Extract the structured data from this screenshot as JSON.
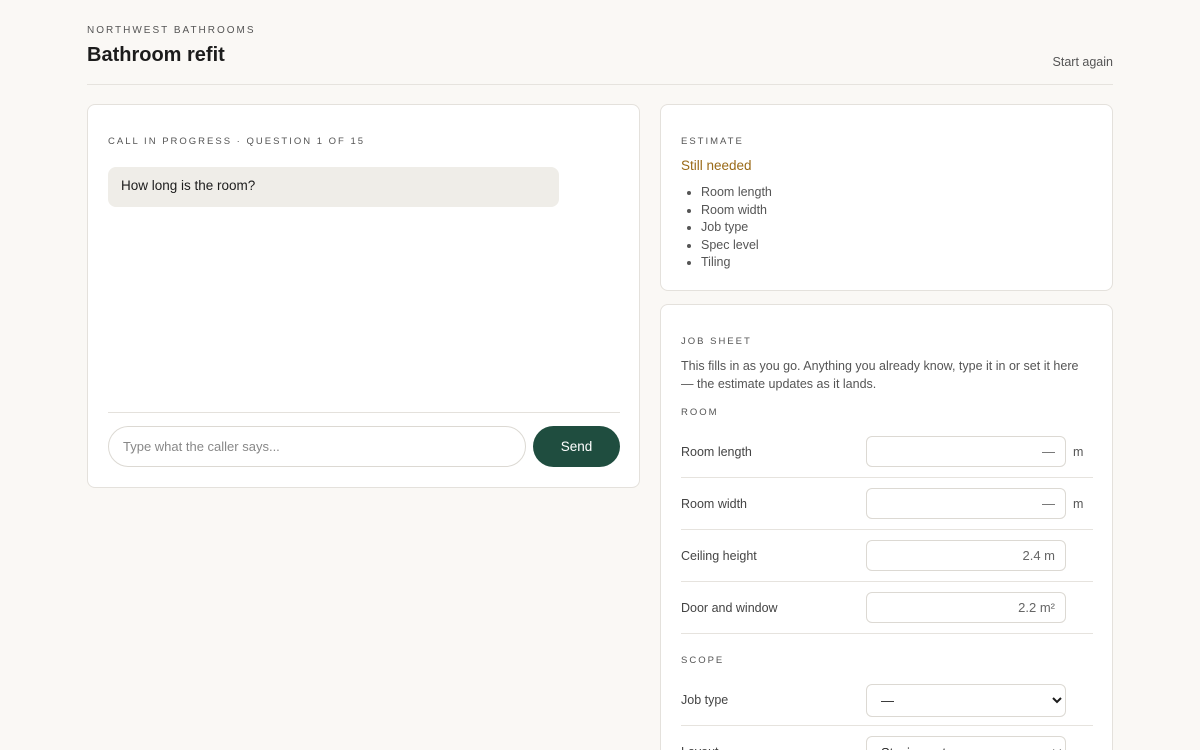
{
  "header": {
    "brand": "NORTHWEST BATHROOMS",
    "title": "Bathroom refit",
    "start_again": "Start again"
  },
  "call": {
    "status": "CALL IN PROGRESS · QUESTION 1 OF 15",
    "question": "How long is the room?",
    "input_placeholder": "Type what the caller says...",
    "send_label": "Send"
  },
  "estimate": {
    "heading": "ESTIMATE",
    "needed_title": "Still needed",
    "needed_items": [
      "Room length",
      "Room width",
      "Job type",
      "Spec level",
      "Tiling"
    ]
  },
  "job_sheet": {
    "heading": "JOB SHEET",
    "description": "This fills in as you go. Anything you already know, type it in or set it here — the estimate updates as it lands.",
    "room_heading": "ROOM",
    "room_rows": [
      {
        "label": "Room length",
        "placeholder": "—",
        "unit": "m"
      },
      {
        "label": "Room width",
        "placeholder": "—",
        "unit": "m"
      },
      {
        "label": "Ceiling height",
        "placeholder": "2.4 m"
      },
      {
        "label": "Door and window",
        "placeholder": "2.2 m²"
      }
    ],
    "scope_heading": "SCOPE",
    "scope_rows": [
      {
        "label": "Job type",
        "selected": "—"
      },
      {
        "label": "Layout",
        "selected": "Staying put"
      }
    ]
  }
}
